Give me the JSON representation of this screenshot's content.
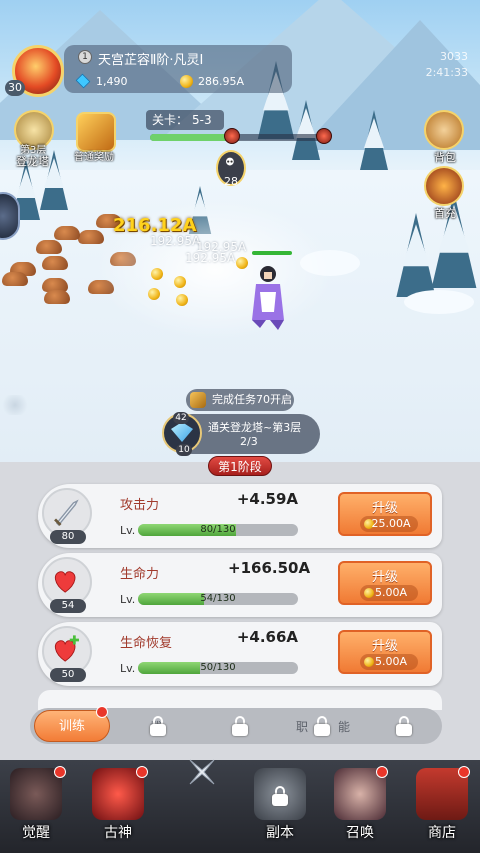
{
  "player": {
    "name": "天宫芷容Ⅱ阶·凡灵Ⅰ",
    "rank": "1",
    "level": "30",
    "gems": "1,490",
    "coins": "286.95A",
    "server_number": "3033",
    "server_time": "2:41:33"
  },
  "side_left": [
    {
      "label": "登龙塔",
      "badge": "第3层"
    },
    {
      "label": "普通奖励"
    }
  ],
  "side_right": [
    {
      "label": "背包"
    },
    {
      "label": "首充"
    }
  ],
  "stage": {
    "label": "关卡：",
    "value": "5-3",
    "progress": 0.45,
    "wave": "28"
  },
  "battle": {
    "big_damage": "216.12A",
    "small_damages": [
      "192.95A",
      "192.95A",
      "192.95A"
    ]
  },
  "task": {
    "text": "完成任务70开启"
  },
  "quest": {
    "title": "通关登龙塔~第3层",
    "progress": "2/3",
    "count": "42",
    "level": "10"
  },
  "phase": "第1阶段",
  "stats": [
    {
      "name": "攻击力",
      "value": "+4.59A",
      "level": "80",
      "lv_label": "Lv.",
      "progress_text": "80/130",
      "progress": 0.615,
      "upgrade_label": "升级",
      "cost": "25.00A",
      "icon": "sword-icon"
    },
    {
      "name": "生命力",
      "value": "+166.50A",
      "level": "54",
      "lv_label": "Lv.",
      "progress_text": "54/130",
      "progress": 0.415,
      "upgrade_label": "升级",
      "cost": "5.00A",
      "icon": "heart-icon"
    },
    {
      "name": "生命恢复",
      "value": "+4.66A",
      "level": "50",
      "lv_label": "Lv.",
      "progress_text": "50/130",
      "progress": 0.385,
      "upgrade_label": "升级",
      "cost": "5.00A",
      "icon": "heart-plus-icon"
    }
  ],
  "tabs": {
    "active": "训练",
    "ghost": [
      "武",
      "职",
      "能"
    ]
  },
  "nav": [
    {
      "label": "觉醒"
    },
    {
      "label": "古神"
    },
    {
      "label": "副本"
    },
    {
      "label": "召唤"
    },
    {
      "label": "商店"
    }
  ],
  "colors": {
    "accent_orange": "#f07a34",
    "progress_green": "#4fa53c",
    "damage_yellow": "#ffd21c",
    "phase_red": "#c72b27"
  }
}
